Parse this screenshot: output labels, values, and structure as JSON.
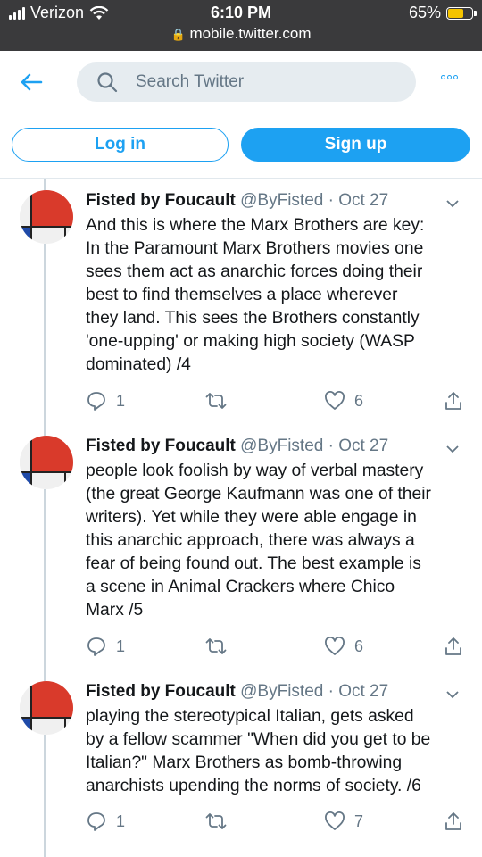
{
  "status_bar": {
    "carrier": "Verizon",
    "time": "6:10 PM",
    "url": "mobile.twitter.com",
    "battery": "65%",
    "battery_level": 0.65
  },
  "header": {
    "search_placeholder": "Search Twitter",
    "login_label": "Log in",
    "signup_label": "Sign up"
  },
  "tweets": [
    {
      "name": "Fisted by Foucault",
      "meta": "@ByFisted · Oct 27",
      "text": "And this is where the Marx Brothers are key:\nIn the Paramount Marx Brothers movies one\nsees them act as anarchic forces doing their\nbest to find themselves a place wherever\nthey land.  This sees the Brothers constantly\n'one-upping' or making high society (WASP\ndominated) /4",
      "replies": "1",
      "likes": "6"
    },
    {
      "name": "Fisted by Foucault",
      "meta": "@ByFisted · Oct 27",
      "text": "people look foolish by way of verbal mastery\n(the great George Kaufmann was one of their\nwriters).  Yet while they were able engage in\nthis anarchic approach, there was always a\nfear of being found out.  The best example is\na scene in Animal Crackers where Chico\nMarx /5",
      "replies": "1",
      "likes": "6"
    },
    {
      "name": "Fisted by Foucault",
      "meta": "@ByFisted · Oct 27",
      "text": "playing the stereotypical Italian, gets asked\nby a fellow scammer \"When did you get to be\nItalian?\"  Marx Brothers as bomb-throwing\nanarchists upending the norms of society. /6",
      "replies": "1",
      "likes": "7"
    }
  ]
}
